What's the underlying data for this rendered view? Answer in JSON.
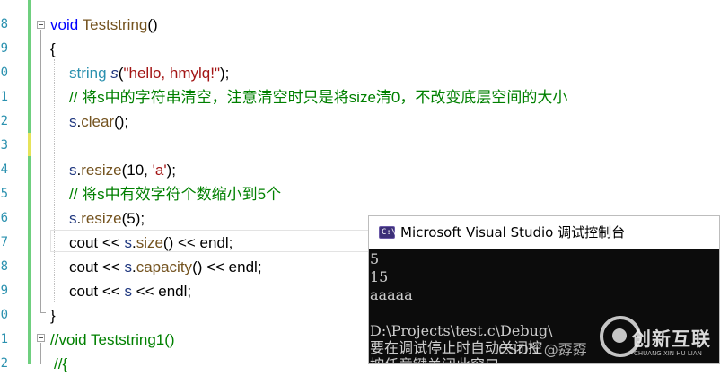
{
  "editor": {
    "line_numbers": [
      "8",
      "9",
      "0",
      "1",
      "2",
      "3",
      "4",
      "5",
      "6",
      "7",
      "8",
      "9",
      "0",
      "1",
      "2"
    ],
    "code": [
      [
        {
          "t": "void ",
          "c": "kw"
        },
        {
          "t": "Teststring",
          "c": "fn"
        },
        {
          "t": "()",
          "c": "op"
        }
      ],
      [
        {
          "t": "{",
          "c": "op"
        }
      ],
      [
        {
          "t": "string ",
          "c": "ty"
        },
        {
          "t": "s",
          "c": "var it"
        },
        {
          "t": "(",
          "c": "op"
        },
        {
          "t": "\"hello, hmylq!\"",
          "c": "str"
        },
        {
          "t": ");",
          "c": "op"
        }
      ],
      [
        {
          "t": "// 将s中的字符串清空，注意清空时只是将size清0，不改变底层空间的大小",
          "c": "cm"
        }
      ],
      [
        {
          "t": "s",
          "c": "var"
        },
        {
          "t": ".",
          "c": "op"
        },
        {
          "t": "clear",
          "c": "fn"
        },
        {
          "t": "();",
          "c": "op"
        }
      ],
      [],
      [
        {
          "t": "s",
          "c": "var"
        },
        {
          "t": ".",
          "c": "op"
        },
        {
          "t": "resize",
          "c": "fn"
        },
        {
          "t": "(10, ",
          "c": "op"
        },
        {
          "t": "'a'",
          "c": "str"
        },
        {
          "t": ");",
          "c": "op"
        }
      ],
      [
        {
          "t": "// 将s中有效字符个数缩小到5个",
          "c": "cm"
        }
      ],
      [
        {
          "t": "s",
          "c": "var"
        },
        {
          "t": ".",
          "c": "op"
        },
        {
          "t": "resize",
          "c": "fn"
        },
        {
          "t": "(5);",
          "c": "op"
        }
      ],
      [
        {
          "t": "cout ",
          "c": "op"
        },
        {
          "t": "<< ",
          "c": "op"
        },
        {
          "t": "s",
          "c": "var"
        },
        {
          "t": ".",
          "c": "op"
        },
        {
          "t": "size",
          "c": "fn"
        },
        {
          "t": "() << endl;",
          "c": "op"
        }
      ],
      [
        {
          "t": "cout ",
          "c": "op"
        },
        {
          "t": "<< ",
          "c": "op"
        },
        {
          "t": "s",
          "c": "var"
        },
        {
          "t": ".",
          "c": "op"
        },
        {
          "t": "capacity",
          "c": "fn"
        },
        {
          "t": "() << endl;",
          "c": "op"
        }
      ],
      [
        {
          "t": "cout ",
          "c": "op"
        },
        {
          "t": "<< ",
          "c": "op"
        },
        {
          "t": "s",
          "c": "var"
        },
        {
          "t": " << endl;",
          "c": "op"
        }
      ],
      [
        {
          "t": "}",
          "c": "op"
        }
      ],
      [
        {
          "t": "//void Teststring1()",
          "c": "cm"
        }
      ],
      [
        {
          "t": "//{",
          "c": "cm"
        }
      ]
    ]
  },
  "console": {
    "title": "Microsoft Visual Studio 调试控制台",
    "icon_label": "C:\\",
    "output": [
      "5",
      "15",
      "aaaaa",
      "",
      "D:\\Projects\\test.c\\Debug\\",
      "要在调试停止时自动关闭控",
      "按任意键关闭此窗口"
    ]
  },
  "watermark": {
    "csdn": "CSDN @孬孬",
    "brand": "创新互联",
    "brand_sub": "CHUANG XIN HU LIAN"
  },
  "icons": [
    "collapse-toggle-icon",
    "console-app-icon",
    "watermark-logo-icon"
  ],
  "colors": {
    "keyword": "#0000ff",
    "type": "#2b91af",
    "function": "#74531f",
    "variable": "#1f377f",
    "string": "#a31515",
    "comment": "#008000",
    "change_bar": "#6fcf7f",
    "console_bg": "#0c0c0c",
    "console_text": "#cccccc"
  }
}
